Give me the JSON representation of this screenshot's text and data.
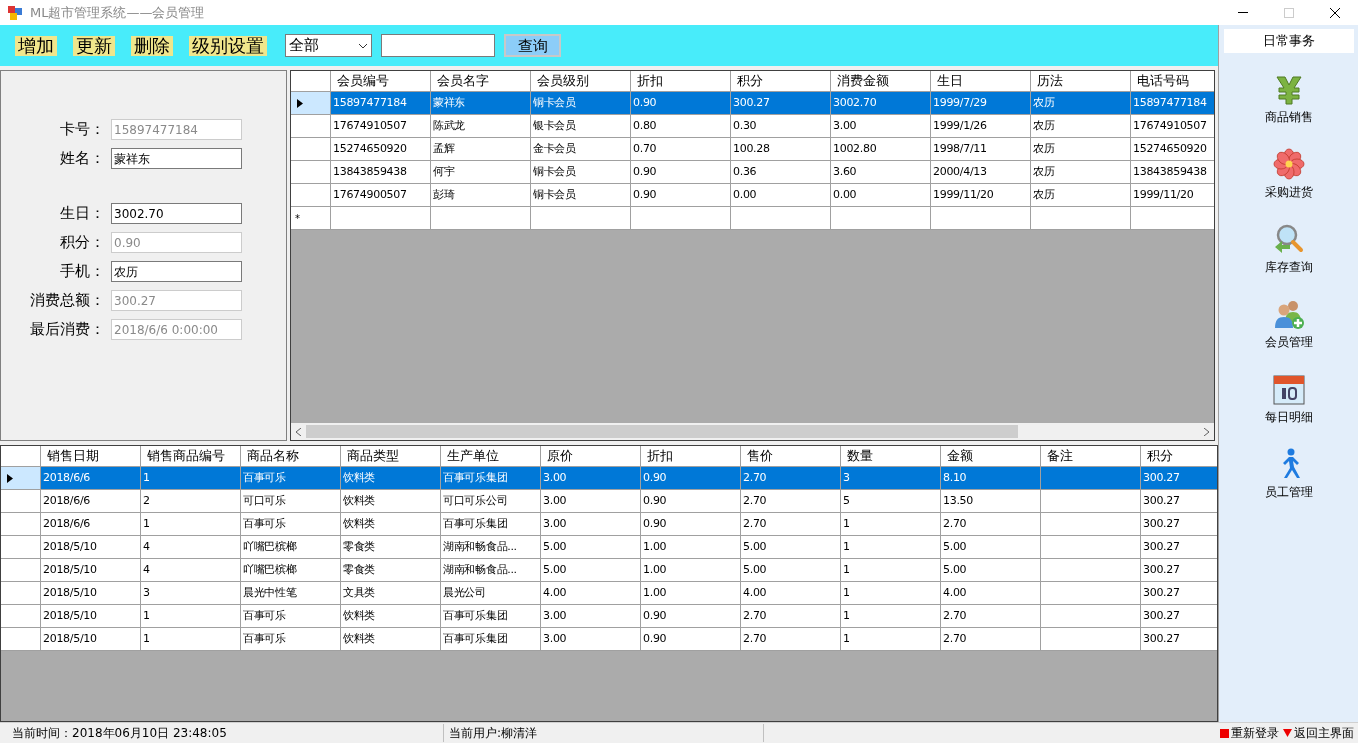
{
  "window": {
    "title": "ML超市管理系统——会员管理"
  },
  "toolbar": {
    "buttons": [
      "增加",
      "更新",
      "删除",
      "级别设置"
    ],
    "filter": {
      "value": "全部"
    },
    "query_button": "查询"
  },
  "member_form": [
    {
      "label": "卡号：",
      "value": "15897477184",
      "disabled": true
    },
    {
      "label": "姓名：",
      "value": "蒙祥东",
      "disabled": false
    },
    {
      "label": "生日：",
      "value": "3002.70",
      "disabled": false,
      "gap_before": true
    },
    {
      "label": "积分：",
      "value": "0.90",
      "disabled": true
    },
    {
      "label": "手机：",
      "value": "农历",
      "disabled": false
    },
    {
      "label": "消费总额：",
      "value": "300.27",
      "disabled": true
    },
    {
      "label": "最后消费：",
      "value": "2018/6/6 0:00:00",
      "disabled": true
    }
  ],
  "members_table": {
    "columns": [
      "会员编号",
      "会员名字",
      "会员级别",
      "折扣",
      "积分",
      "消费金额",
      "生日",
      "历法",
      "电话号码"
    ],
    "rows": [
      {
        "selected": true,
        "cells": [
          "15897477184",
          "蒙祥东",
          "铜卡会员",
          "0.90",
          "300.27",
          "3002.70",
          "1999/7/29",
          "农历",
          "15897477184"
        ]
      },
      {
        "selected": false,
        "cells": [
          "17674910507",
          "陈武龙",
          "银卡会员",
          "0.80",
          "0.30",
          "3.00",
          "1999/1/26",
          "农历",
          "17674910507"
        ]
      },
      {
        "selected": false,
        "cells": [
          "15274650920",
          "孟辉",
          "金卡会员",
          "0.70",
          "100.28",
          "1002.80",
          "1998/7/11",
          "农历",
          "15274650920"
        ]
      },
      {
        "selected": false,
        "cells": [
          "13843859438",
          "何宇",
          "铜卡会员",
          "0.90",
          "0.36",
          "3.60",
          "2000/4/13",
          "农历",
          "13843859438"
        ]
      },
      {
        "selected": false,
        "cells": [
          "17674900507",
          "彭琦",
          "铜卡会员",
          "0.90",
          "0.00",
          "0.00",
          "1999/11/20",
          "农历",
          "1999/11/20"
        ]
      }
    ],
    "new_row_marker": "*"
  },
  "sales_table": {
    "columns": [
      "销售日期",
      "销售商品编号",
      "商品名称",
      "商品类型",
      "生产单位",
      "原价",
      "折扣",
      "售价",
      "数量",
      "金额",
      "备注",
      "积分"
    ],
    "rows": [
      {
        "selected": true,
        "cells": [
          "2018/6/6",
          "1",
          "百事可乐",
          "饮料类",
          "百事可乐集团",
          "3.00",
          "0.90",
          "2.70",
          "3",
          "8.10",
          "",
          "300.27"
        ]
      },
      {
        "selected": false,
        "cells": [
          "2018/6/6",
          "2",
          "可口可乐",
          "饮料类",
          "可口可乐公司",
          "3.00",
          "0.90",
          "2.70",
          "5",
          "13.50",
          "",
          "300.27"
        ]
      },
      {
        "selected": false,
        "cells": [
          "2018/6/6",
          "1",
          "百事可乐",
          "饮料类",
          "百事可乐集团",
          "3.00",
          "0.90",
          "2.70",
          "1",
          "2.70",
          "",
          "300.27"
        ]
      },
      {
        "selected": false,
        "cells": [
          "2018/5/10",
          "4",
          "吖嘴巴槟榔",
          "零食类",
          "湖南和畅食品...",
          "5.00",
          "1.00",
          "5.00",
          "1",
          "5.00",
          "",
          "300.27"
        ]
      },
      {
        "selected": false,
        "cells": [
          "2018/5/10",
          "4",
          "吖嘴巴槟榔",
          "零食类",
          "湖南和畅食品...",
          "5.00",
          "1.00",
          "5.00",
          "1",
          "5.00",
          "",
          "300.27"
        ]
      },
      {
        "selected": false,
        "cells": [
          "2018/5/10",
          "3",
          "晨光中性笔",
          "文具类",
          "晨光公司",
          "4.00",
          "1.00",
          "4.00",
          "1",
          "4.00",
          "",
          "300.27"
        ]
      },
      {
        "selected": false,
        "cells": [
          "2018/5/10",
          "1",
          "百事可乐",
          "饮料类",
          "百事可乐集团",
          "3.00",
          "0.90",
          "2.70",
          "1",
          "2.70",
          "",
          "300.27"
        ]
      },
      {
        "selected": false,
        "cells": [
          "2018/5/10",
          "1",
          "百事可乐",
          "饮料类",
          "百事可乐集团",
          "3.00",
          "0.90",
          "2.70",
          "1",
          "2.70",
          "",
          "300.27"
        ]
      }
    ]
  },
  "sidebar": {
    "title": "日常事务",
    "items": [
      {
        "label": "商品销售",
        "kind": "yen"
      },
      {
        "label": "采购进货",
        "kind": "flower"
      },
      {
        "label": "库存查询",
        "kind": "magnifier"
      },
      {
        "label": "会员管理",
        "kind": "people"
      },
      {
        "label": "每日明细",
        "kind": "calendar"
      },
      {
        "label": "员工管理",
        "kind": "walker"
      }
    ]
  },
  "status_bar": {
    "time": "当前时间：2018年06月10日  23:48:05",
    "user": "当前用户:柳清洋",
    "links": [
      {
        "label": "重新登录",
        "kind": "square"
      },
      {
        "label": "返回主界面",
        "kind": "triangle"
      }
    ]
  }
}
